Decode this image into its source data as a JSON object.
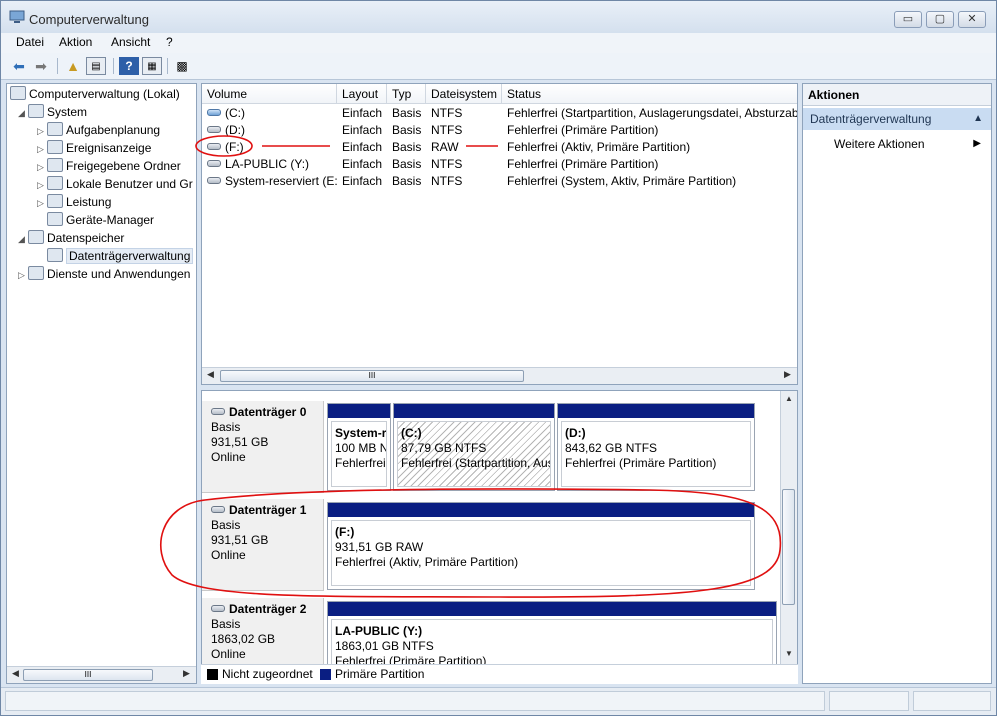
{
  "window": {
    "title": "Computerverwaltung",
    "controls": {
      "minimize": "▭",
      "maximize": "▢",
      "close": "✕"
    }
  },
  "menu": [
    "Datei",
    "Aktion",
    "Ansicht",
    "?"
  ],
  "toolbar": {
    "icons": [
      "back-arrow-icon",
      "forward-arrow-icon",
      "up-folder-icon",
      "console-tree-icon",
      "help-icon",
      "properties-icon",
      "disk-settings-icon"
    ]
  },
  "tree": {
    "items": [
      {
        "label": "Computerverwaltung (Lokal)",
        "level": 0,
        "expander": ""
      },
      {
        "label": "System",
        "level": 1,
        "expander": "◢"
      },
      {
        "label": "Aufgabenplanung",
        "level": 2,
        "expander": "▷"
      },
      {
        "label": "Ereignisanzeige",
        "level": 2,
        "expander": "▷"
      },
      {
        "label": "Freigegebene Ordner",
        "level": 2,
        "expander": "▷"
      },
      {
        "label": "Lokale Benutzer und Gr",
        "level": 2,
        "expander": "▷"
      },
      {
        "label": "Leistung",
        "level": 2,
        "expander": "▷"
      },
      {
        "label": "Geräte-Manager",
        "level": 2,
        "expander": ""
      },
      {
        "label": "Datenspeicher",
        "level": 1,
        "expander": "◢"
      },
      {
        "label": "Datenträgerverwaltung",
        "level": 2,
        "expander": "",
        "selected": true
      },
      {
        "label": "Dienste und Anwendungen",
        "level": 1,
        "expander": "▷"
      }
    ],
    "scroll_thumb": "III"
  },
  "volumes": {
    "columns": [
      "Volume",
      "Layout",
      "Typ",
      "Dateisystem",
      "Status"
    ],
    "rows": [
      {
        "volume": "(C:)",
        "layout": "Einfach",
        "typ": "Basis",
        "fs": "NTFS",
        "status": "Fehlerfrei (Startpartition, Auslagerungsdatei, Absturzab",
        "icon": "blue"
      },
      {
        "volume": "(D:)",
        "layout": "Einfach",
        "typ": "Basis",
        "fs": "NTFS",
        "status": "Fehlerfrei (Primäre Partition)",
        "icon": "grey"
      },
      {
        "volume": "(F:)",
        "layout": "Einfach",
        "typ": "Basis",
        "fs": "RAW",
        "status": "Fehlerfrei (Aktiv, Primäre Partition)",
        "icon": "grey"
      },
      {
        "volume": "LA-PUBLIC (Y:)",
        "layout": "Einfach",
        "typ": "Basis",
        "fs": "NTFS",
        "status": "Fehlerfrei (Primäre Partition)",
        "icon": "grey"
      },
      {
        "volume": "System-reserviert (E:)",
        "layout": "Einfach",
        "typ": "Basis",
        "fs": "NTFS",
        "status": "Fehlerfrei (System, Aktiv, Primäre Partition)",
        "icon": "grey"
      }
    ],
    "scroll_thumb": "III"
  },
  "disks": [
    {
      "name": "Datenträger 0",
      "type": "Basis",
      "size": "931,51 GB",
      "state": "Online",
      "partitions": [
        {
          "name": "System-r",
          "size": "100 MB N",
          "status": "Fehlerfrei",
          "hatched": false
        },
        {
          "name": "(C:)",
          "size": "87,79 GB NTFS",
          "status": "Fehlerfrei (Startpartition, Aus",
          "hatched": true
        },
        {
          "name": "(D:)",
          "size": "843,62 GB NTFS",
          "status": "Fehlerfrei (Primäre Partition)",
          "hatched": false
        }
      ]
    },
    {
      "name": "Datenträger 1",
      "type": "Basis",
      "size": "931,51 GB",
      "state": "Online",
      "partitions": [
        {
          "name": "(F:)",
          "size": "931,51 GB RAW",
          "status": "Fehlerfrei (Aktiv, Primäre Partition)",
          "hatched": false
        }
      ]
    },
    {
      "name": "Datenträger 2",
      "type": "Basis",
      "size": "1863,02 GB",
      "state": "Online",
      "partitions": [
        {
          "name": "LA-PUBLIC  (Y:)",
          "size": "1863,01 GB NTFS",
          "status": "Fehlerfrei (Primäre Partition)",
          "hatched": false
        }
      ]
    }
  ],
  "legend": [
    {
      "label": "Nicht zugeordnet",
      "color": "#000000"
    },
    {
      "label": "Primäre Partition",
      "color": "#0a1e82"
    }
  ],
  "actions": {
    "header": "Aktionen",
    "section": "Datenträgerverwaltung",
    "item": "Weitere Aktionen"
  },
  "colors": {
    "partition_bar": "#0a1e82",
    "annotation": "#e01010",
    "selection": "#c9dcf2"
  }
}
